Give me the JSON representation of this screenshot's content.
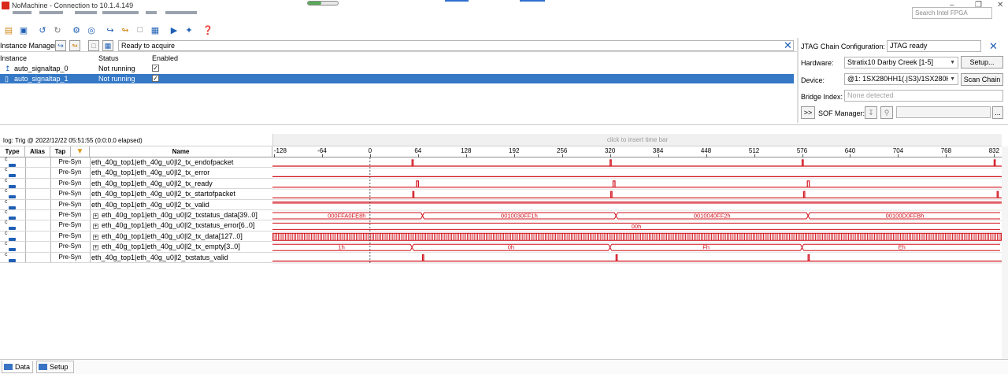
{
  "window": {
    "title": "NoMachine - Connection to 10.1.4.149",
    "progress": 0.45,
    "controls": [
      "–",
      "❐",
      "✕"
    ]
  },
  "search": {
    "placeholder": "Search Intel FPGA"
  },
  "instance_manager": {
    "label": "Instance Manager:",
    "status_text": "Ready to acquire",
    "columns": [
      "Instance",
      "Status",
      "Enabled"
    ],
    "rows": [
      {
        "name": "auto_signaltap_0",
        "status": "Not running",
        "enabled": true,
        "selected": false
      },
      {
        "name": "auto_signaltap_1",
        "status": "Not running",
        "enabled": true,
        "selected": true
      }
    ]
  },
  "jtag": {
    "config_label": "JTAG Chain Configuration:",
    "config_status": "JTAG ready",
    "hardware_label": "Hardware:",
    "hardware_value": "Stratix10 Darby Creek [1-5]",
    "setup_button": "Setup...",
    "device_label": "Device:",
    "device_value": "@1: 1SX280HH1(.|S3)/1SX280H",
    "scan_button": "Scan Chain",
    "bridge_label": "Bridge Index:",
    "bridge_value": "None detected",
    "expand_button": ">>",
    "sof_label": "SOF Manager:",
    "browse_button": "..."
  },
  "waveform": {
    "log_text": "log: Trig @ 2022/12/22 05:51:55 (0:0:0.0 elapsed)",
    "insert_bar_text": "click to insert time bar",
    "columns": [
      "Type",
      "Alias",
      "Tap",
      "Name"
    ],
    "scale_ticks": [
      "-128",
      "-64",
      "0",
      "64",
      "128",
      "192",
      "256",
      "320",
      "384",
      "448",
      "512",
      "576",
      "640",
      "704",
      "768",
      "832"
    ],
    "signals": [
      {
        "tap": "Pre-Syn",
        "name": "eth_40g_top1|eth_40g_u0|l2_tx_endofpacket",
        "group": false
      },
      {
        "tap": "Pre-Syn",
        "name": "eth_40g_top1|eth_40g_u0|l2_tx_error",
        "group": false
      },
      {
        "tap": "Pre-Syn",
        "name": "eth_40g_top1|eth_40g_u0|l2_tx_ready",
        "group": false
      },
      {
        "tap": "Pre-Syn",
        "name": "eth_40g_top1|eth_40g_u0|l2_tx_startofpacket",
        "group": false
      },
      {
        "tap": "Pre-Syn",
        "name": "eth_40g_top1|eth_40g_u0|l2_tx_valid",
        "group": false
      },
      {
        "tap": "Pre-Syn",
        "name": "eth_40g_top1|eth_40g_u0|l2_txstatus_data[39..0]",
        "group": true
      },
      {
        "tap": "Pre-Syn",
        "name": "eth_40g_top1|eth_40g_u0|l2_txstatus_error[6..0]",
        "group": true
      },
      {
        "tap": "Pre-Syn",
        "name": "eth_40g_top1|eth_40g_u0|l2_tx_data[127..0]",
        "group": true
      },
      {
        "tap": "Pre-Syn",
        "name": "eth_40g_top1|eth_40g_u0|l2_tx_empty[3..0]",
        "group": true
      },
      {
        "tap": "Pre-Syn",
        "name": "eth_40g_top1|eth_40g_u0|l2_txstatus_valid",
        "group": false
      }
    ],
    "bus_values": {
      "txstatus_data": [
        "000FFA0FE8h",
        "0010030FF1h",
        "0010040FF2h",
        "00100D0FFBh"
      ],
      "txstatus_error": [
        "00h"
      ],
      "tx_empty": [
        "1h",
        "0h",
        "Fh",
        "Eh"
      ]
    },
    "wave_color": "#d0101a"
  },
  "bottom_tabs": [
    "Data",
    "Setup"
  ]
}
